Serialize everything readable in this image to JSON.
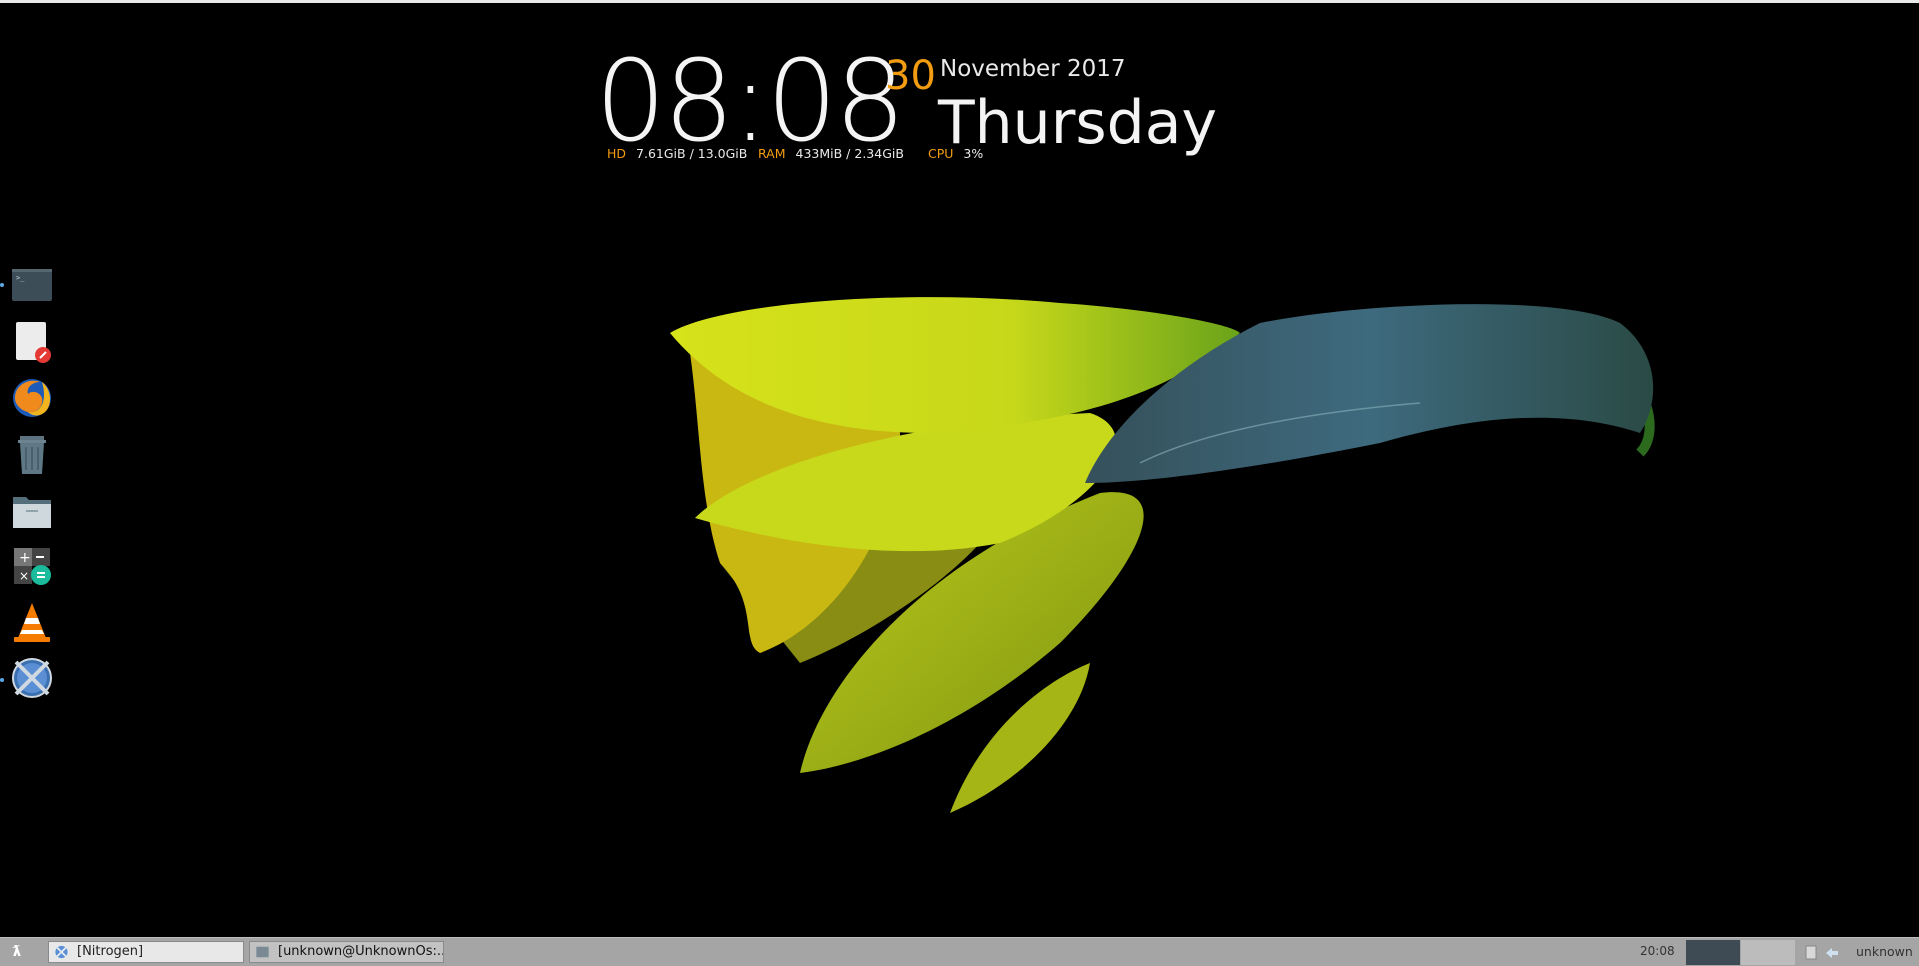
{
  "clock": {
    "time": "08:08",
    "day": "30",
    "month_year": "November 2017",
    "weekday": "Thursday"
  },
  "stats": {
    "hd_label": "HD",
    "hd_value": "7.61GiB / 13.0GiB",
    "ram_label": "RAM",
    "ram_value": "433MiB / 2.34GiB",
    "cpu_label": "CPU",
    "cpu_value": "3%"
  },
  "dock": {
    "items": [
      {
        "icon": "terminal-icon",
        "running": true
      },
      {
        "icon": "text-editor-icon",
        "running": false
      },
      {
        "icon": "firefox-icon",
        "running": false
      },
      {
        "icon": "trash-icon",
        "running": false
      },
      {
        "icon": "file-manager-icon",
        "running": false
      },
      {
        "icon": "calculator-icon",
        "running": false
      },
      {
        "icon": "vlc-icon",
        "running": false
      },
      {
        "icon": "nitrogen-icon",
        "running": true
      }
    ]
  },
  "taskbar": {
    "menu_glyph": "ƛ",
    "tasks": [
      {
        "label": "[Nitrogen]",
        "icon": "nitrogen-icon",
        "active": true
      },
      {
        "label": "[unknown@UnknownOs:...",
        "icon": "terminal-icon",
        "active": false
      }
    ],
    "time": "20:08",
    "user": "unknown"
  },
  "colors": {
    "accent": "#f39c12",
    "taskbar": "#a5a5a5",
    "workspace_active": "#3e4b55"
  }
}
